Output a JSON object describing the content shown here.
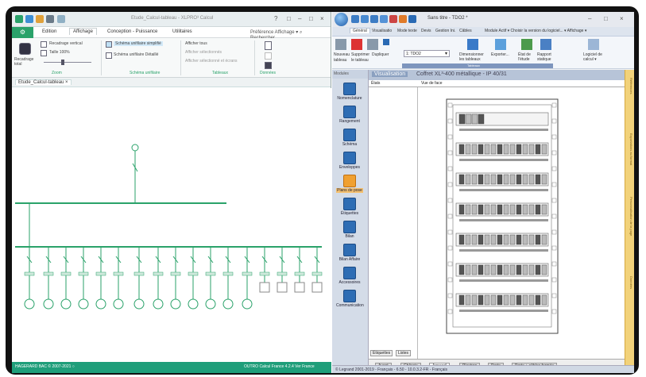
{
  "left_app": {
    "title": "Etude_Calcul-tableau - XLPRO³ Calcul",
    "file_tab": "⚙",
    "tabs": [
      "Edition",
      "Affichage",
      "Conception - Puissance",
      "Utilitaires"
    ],
    "active_tab": "Affichage",
    "search_text": "Préférence Affichage ▾  ⌕ Rechercher...",
    "ribbon": {
      "recadrage_total": "Recadrage total",
      "recadrage_vertical": "Recadrage vertical",
      "taille": "Taille 100%",
      "zoom_label": "Zoom",
      "schema_unifilaire_simplifie": "Schéma unifilaire simplifié",
      "schema_unifilaire_detaille": "Schéma unifilaire Détaillé",
      "schema_label": "Schéma unifilaire",
      "afficher_tous": "Afficher tous",
      "afficher_selectionnes": "Afficher sélectionnés",
      "afficher_selectionne_ecrans": "Afficher sélectionné et écrans",
      "tableaux_label": "Tableaux",
      "donnees_label": "Données"
    },
    "doc_tab": "Etude_Calcul-tableau  ×",
    "status_left": "HAGERARD BAC © 2007-2021 ○",
    "status_right": "OUTRO Calcul France 4.2.4 Ver France"
  },
  "right_app": {
    "title": "Sans titre - TDO2 *",
    "tabs": [
      "Général",
      "Visualisatio",
      "Mode texte",
      "Devis",
      "Gestion Ini.",
      "Câbles"
    ],
    "active_tab": "Général",
    "extra_menu": "Module Actif ▾  Choisir la version du logiciel...  ▾  Affichage ▾",
    "ribbon": {
      "nouveau": "Nouveau",
      "supprimer": "Supprimer",
      "dupliquer": "Dupliquer",
      "tableau": "tableau",
      "tableau2": "le tableau",
      "combo": "1: TDO2",
      "dimensionner": "Dimensionner les tableaux",
      "exporter": "Exporter...",
      "etat": "État de l'étude",
      "rapport": "Rapport statique",
      "logiciel": "Logiciel de calcul ▾",
      "group": "Tableaux"
    },
    "modules_title": "Modules",
    "modules": [
      "Nomenclature",
      "Rangement",
      "Schéma",
      "Enveloppes",
      "Plans de pose",
      "Étiquettes",
      "Bilan",
      "Bilan Affaire",
      "Accessoires",
      "Communication"
    ],
    "selected_module": "Plans de pose",
    "viz_tab": "Visualisation",
    "viz_title": "Coffret XL³-400 métallique - IP 40/31",
    "col_etats": "États",
    "col_vue": "Vue de face",
    "left_tabs": [
      "Etiquettes",
      "Listes"
    ],
    "bottom_tabs": [
      "Avant",
      "Châssis",
      "Appareil",
      "Plastron",
      "Porte",
      "Porte + câbles fermée"
    ],
    "active_bottom_tab": "Appareil",
    "sidebar": [
      "Références",
      "Exportations au format",
      "Personnalisation de la page",
      "Données"
    ],
    "status": "© Legrand 2001-2019 - Français - 6.50 - 10.0.3.2-FR - Français"
  }
}
